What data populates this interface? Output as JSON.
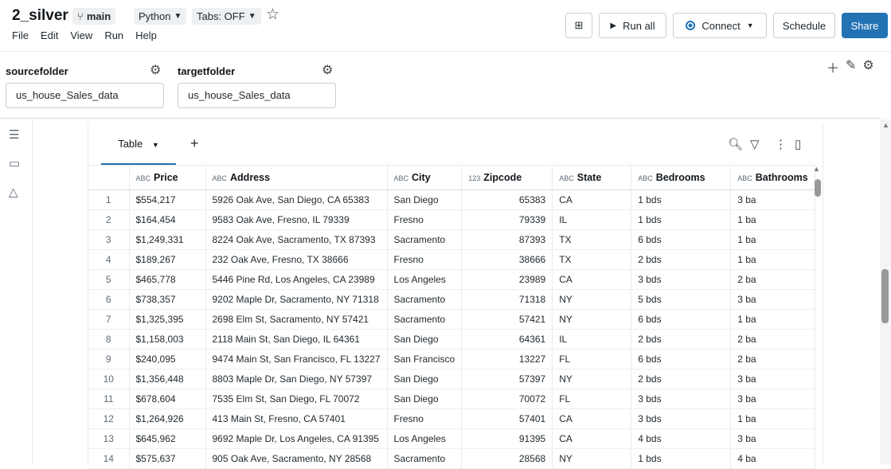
{
  "header": {
    "title": "2_silver",
    "branch": "main",
    "language": "Python",
    "tabs_toggle": "Tabs: OFF",
    "menu": [
      "File",
      "Edit",
      "View",
      "Run",
      "Help"
    ],
    "run_all": "Run all",
    "connect": "Connect",
    "schedule": "Schedule",
    "share": "Share"
  },
  "params": {
    "source_label": "sourcefolder",
    "source_value": "us_house_Sales_data",
    "target_label": "targetfolder",
    "target_value": "us_house_Sales_data"
  },
  "results": {
    "tab_label": "Table",
    "columns": [
      {
        "name": "",
        "type": ""
      },
      {
        "name": "Price",
        "type": "ABC"
      },
      {
        "name": "Address",
        "type": "ABC"
      },
      {
        "name": "City",
        "type": "ABC"
      },
      {
        "name": "Zipcode",
        "type": "123"
      },
      {
        "name": "State",
        "type": "ABC"
      },
      {
        "name": "Bedrooms",
        "type": "ABC"
      },
      {
        "name": "Bathrooms",
        "type": "ABC"
      }
    ],
    "rows": [
      [
        "1",
        "$554,217",
        "5926 Oak Ave, San Diego, CA 65383",
        "San Diego",
        "65383",
        "CA",
        "1 bds",
        "3 ba"
      ],
      [
        "2",
        "$164,454",
        "9583 Oak Ave, Fresno, IL 79339",
        "Fresno",
        "79339",
        "IL",
        "1 bds",
        "1 ba"
      ],
      [
        "3",
        "$1,249,331",
        "8224 Oak Ave, Sacramento, TX 87393",
        "Sacramento",
        "87393",
        "TX",
        "6 bds",
        "1 ba"
      ],
      [
        "4",
        "$189,267",
        "232 Oak Ave, Fresno, TX 38666",
        "Fresno",
        "38666",
        "TX",
        "2 bds",
        "1 ba"
      ],
      [
        "5",
        "$465,778",
        "5446 Pine Rd, Los Angeles, CA 23989",
        "Los Angeles",
        "23989",
        "CA",
        "3 bds",
        "2 ba"
      ],
      [
        "6",
        "$738,357",
        "9202 Maple Dr, Sacramento, NY 71318",
        "Sacramento",
        "71318",
        "NY",
        "5 bds",
        "3 ba"
      ],
      [
        "7",
        "$1,325,395",
        "2698 Elm St, Sacramento, NY 57421",
        "Sacramento",
        "57421",
        "NY",
        "6 bds",
        "1 ba"
      ],
      [
        "8",
        "$1,158,003",
        "2118 Main St, San Diego, IL 64361",
        "San Diego",
        "64361",
        "IL",
        "2 bds",
        "2 ba"
      ],
      [
        "9",
        "$240,095",
        "9474 Main St, San Francisco, FL 13227",
        "San Francisco",
        "13227",
        "FL",
        "6 bds",
        "2 ba"
      ],
      [
        "10",
        "$1,356,448",
        "8803 Maple Dr, San Diego, NY 57397",
        "San Diego",
        "57397",
        "NY",
        "2 bds",
        "3 ba"
      ],
      [
        "11",
        "$678,604",
        "7535 Elm St, San Diego, FL 70072",
        "San Diego",
        "70072",
        "FL",
        "3 bds",
        "3 ba"
      ],
      [
        "12",
        "$1,264,926",
        "413 Main St, Fresno, CA 57401",
        "Fresno",
        "57401",
        "CA",
        "3 bds",
        "1 ba"
      ],
      [
        "13",
        "$645,962",
        "9692 Maple Dr, Los Angeles, CA 91395",
        "Los Angeles",
        "91395",
        "CA",
        "4 bds",
        "3 ba"
      ],
      [
        "14",
        "$575,637",
        "905 Oak Ave, Sacramento, NY 28568",
        "Sacramento",
        "28568",
        "NY",
        "1 bds",
        "4 ba"
      ]
    ]
  }
}
